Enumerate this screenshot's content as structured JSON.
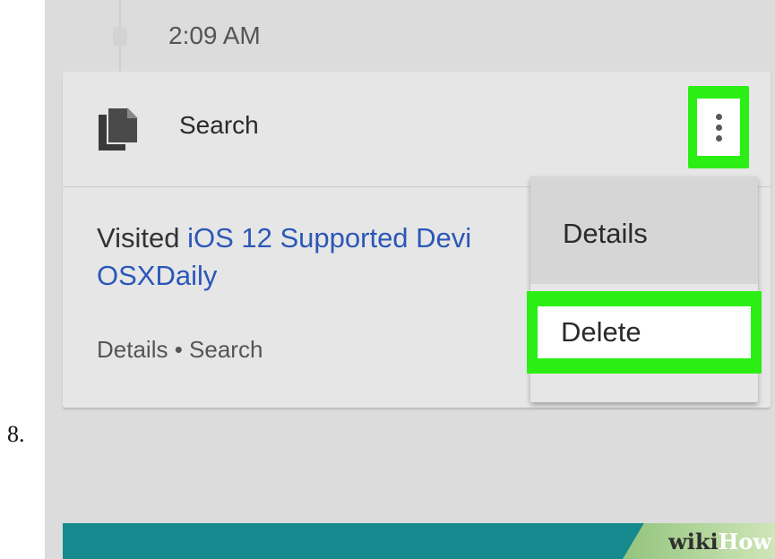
{
  "step": {
    "number": "8."
  },
  "timeline": {
    "time": "2:09 AM"
  },
  "card": {
    "title": "Search",
    "body_prefix": "Visited ",
    "link_line1": "iOS 12 Supported Devi",
    "link_line2": "OSXDaily",
    "meta": "Details • Search",
    "icon": "document-icon"
  },
  "menu": {
    "items": [
      {
        "label": "Details"
      },
      {
        "label": "Delete"
      }
    ],
    "more_icon": "vertical-dots-icon"
  },
  "watermark": {
    "wiki": "wiki",
    "how": "How"
  },
  "colors": {
    "highlight": "#2bef14",
    "link": "#2b57b8",
    "bottom_bar": "#168a8e"
  }
}
